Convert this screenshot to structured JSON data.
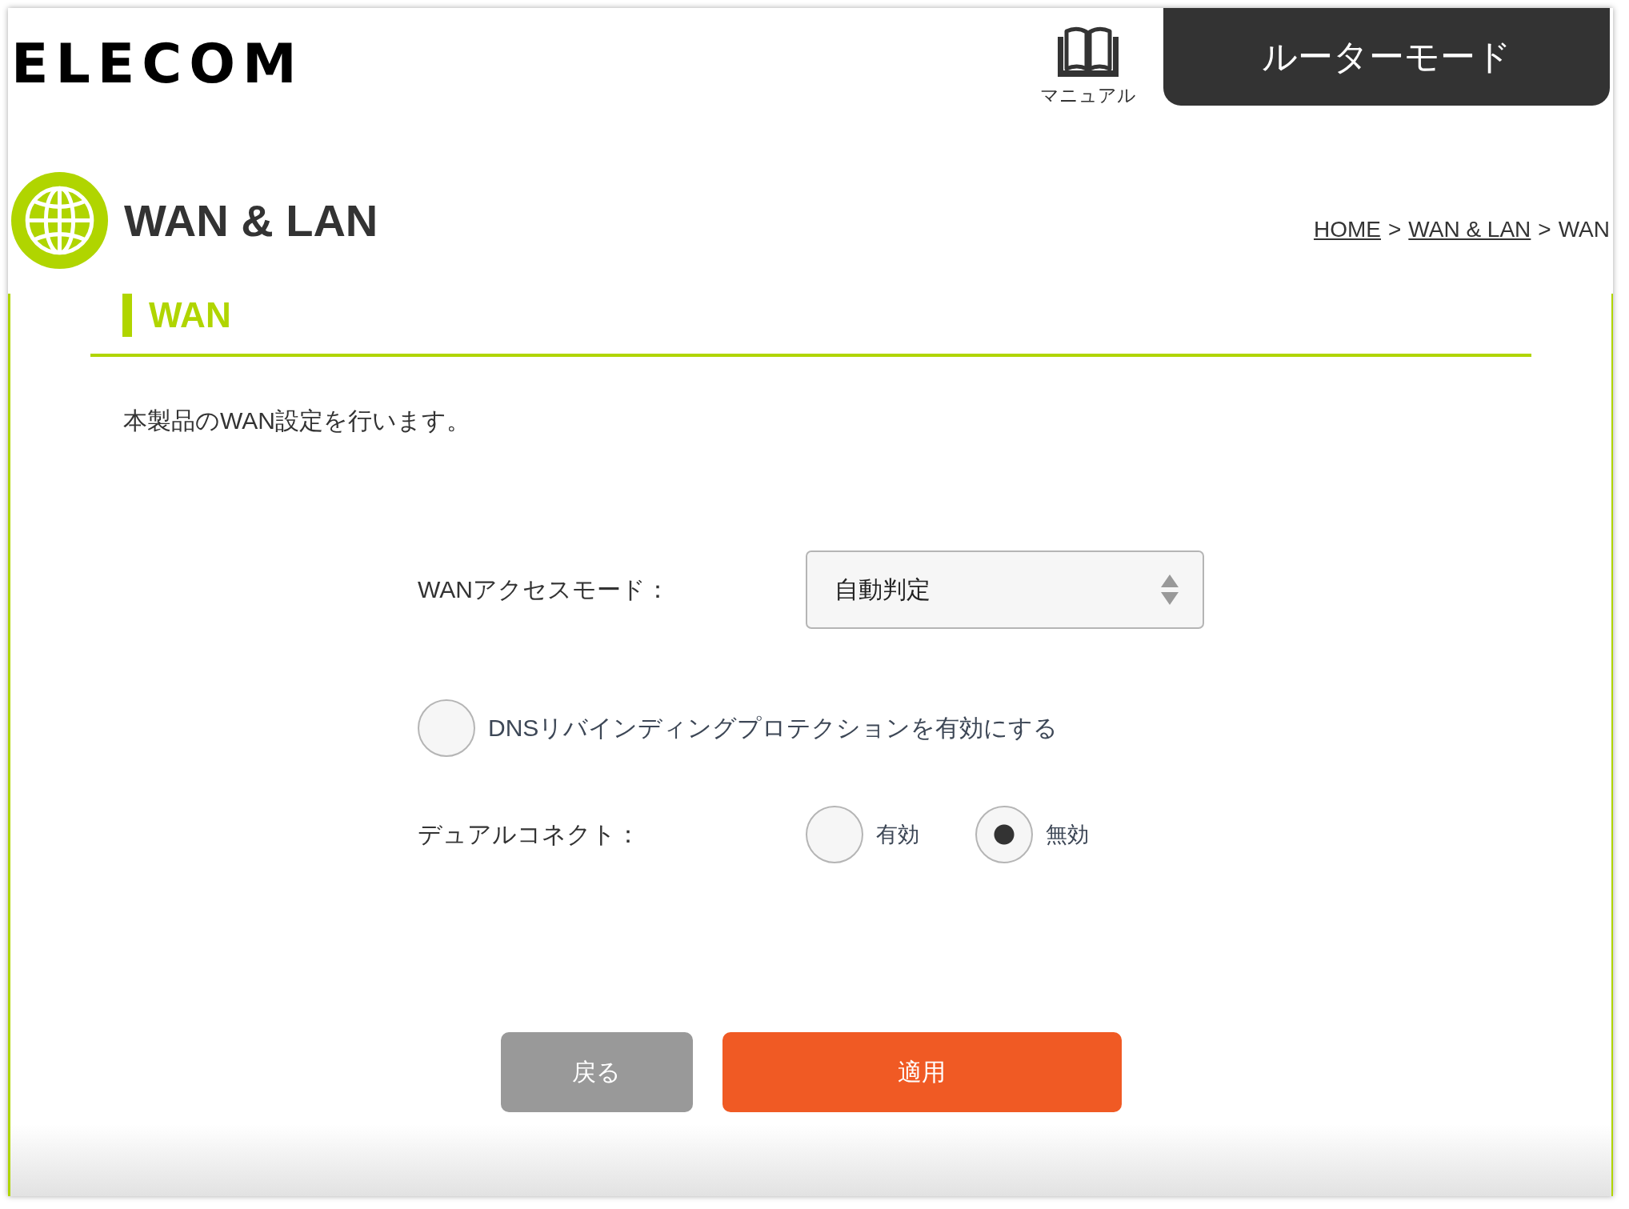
{
  "header": {
    "logo": "ELECOM",
    "manual_link": "マニュアル",
    "mode_tab": "ルーターモード"
  },
  "page_header": {
    "title": "WAN & LAN",
    "breadcrumb": [
      {
        "kind": "link",
        "label": "HOME"
      },
      {
        "kind": "separator",
        "label": ">"
      },
      {
        "kind": "link",
        "label": "WAN & LAN"
      },
      {
        "kind": "separator",
        "label": ">"
      },
      {
        "kind": "current",
        "label": "WAN"
      }
    ]
  },
  "section": {
    "heading": "WAN",
    "description": "本製品のWAN設定を行います。"
  },
  "form": {
    "rows": [
      {
        "kind": "select",
        "label": "WANアクセスモード：",
        "value": "自動判定"
      },
      {
        "kind": "checkbox",
        "label": "DNSリバインディングプロテクションを有効にする",
        "checked": false
      },
      {
        "kind": "radio",
        "label": "デュアルコネクト：",
        "options": [
          {
            "label": "有効",
            "selected": false
          },
          {
            "label": "無効",
            "selected": true
          }
        ]
      }
    ]
  },
  "buttons": [
    {
      "kind": "back",
      "label": "戻る"
    },
    {
      "kind": "apply",
      "label": "適用"
    }
  ]
}
